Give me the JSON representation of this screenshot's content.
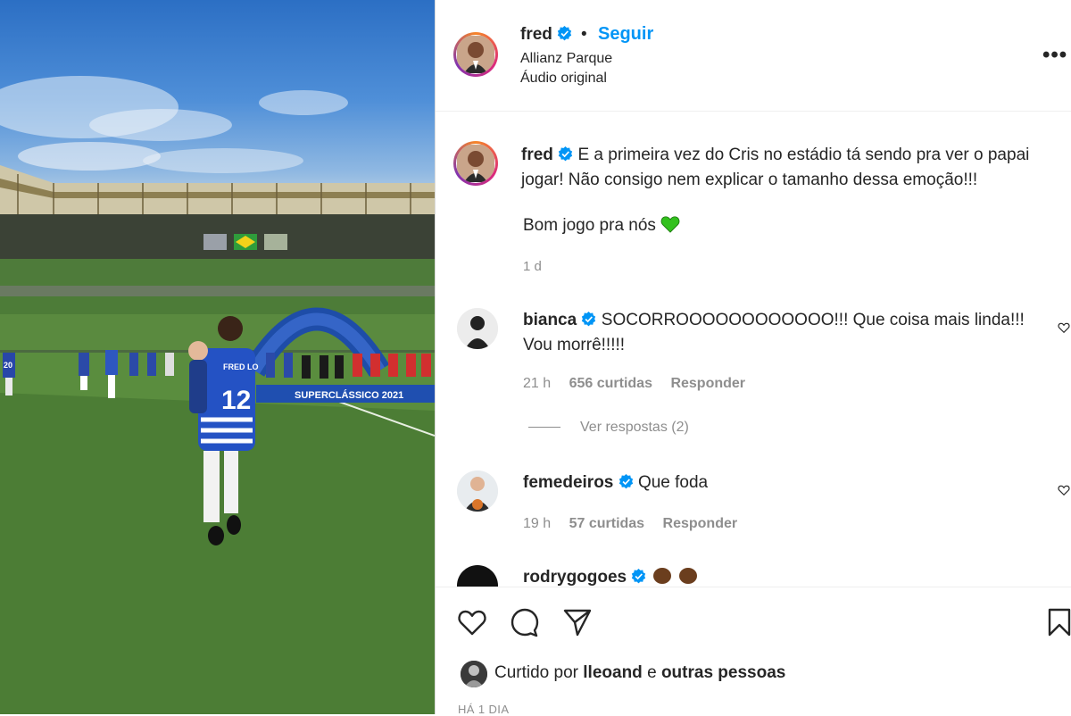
{
  "post": {
    "author": "fred",
    "follow_label": "Seguir",
    "separator": "•",
    "location": "Allianz Parque",
    "audio": "Áudio original",
    "more_label": "•••",
    "caption_user": "fred",
    "caption_text": "E a primeira vez do Cris no estádio tá sendo pra ver o papai jogar! Não consigo nem explicar o tamanho dessa emoção!!!",
    "caption_line2": "Bom jogo pra nós",
    "caption_time": "1 d"
  },
  "media": {
    "banner_text": "SUPERCLÁSSICO 2021",
    "jersey_name": "FRED LO",
    "jersey_number": "12",
    "player_number_left": "20"
  },
  "comments": [
    {
      "user": "bianca",
      "text": "SOCORROOOOOOOOOOOO!!! Que coisa mais linda!!! Vou morrê!!!!!",
      "time": "21 h",
      "likes": "656 curtidas",
      "reply": "Responder"
    },
    {
      "user": "femedeiros",
      "text": "Que foda",
      "time": "19 h",
      "likes": "57 curtidas",
      "reply": "Responder"
    },
    {
      "user": "rodrygogoes",
      "text": ""
    }
  ],
  "view_replies": "Ver respostas (2)",
  "likes": {
    "prefix": "Curtido por",
    "user": "lleoand",
    "connector": "e",
    "others": "outras pessoas"
  },
  "date": "HÁ 1 DIA",
  "colors": {
    "accent": "#0095f6",
    "verified": "#0095f6",
    "text": "#262626",
    "muted": "#8e8e8e",
    "green_heart": "#32c11d"
  },
  "icons": [
    "verified-badge-icon",
    "heart-icon",
    "comment-icon",
    "share-icon",
    "bookmark-icon",
    "more-icon",
    "green-heart-icon",
    "clap-emoji-icon"
  ]
}
